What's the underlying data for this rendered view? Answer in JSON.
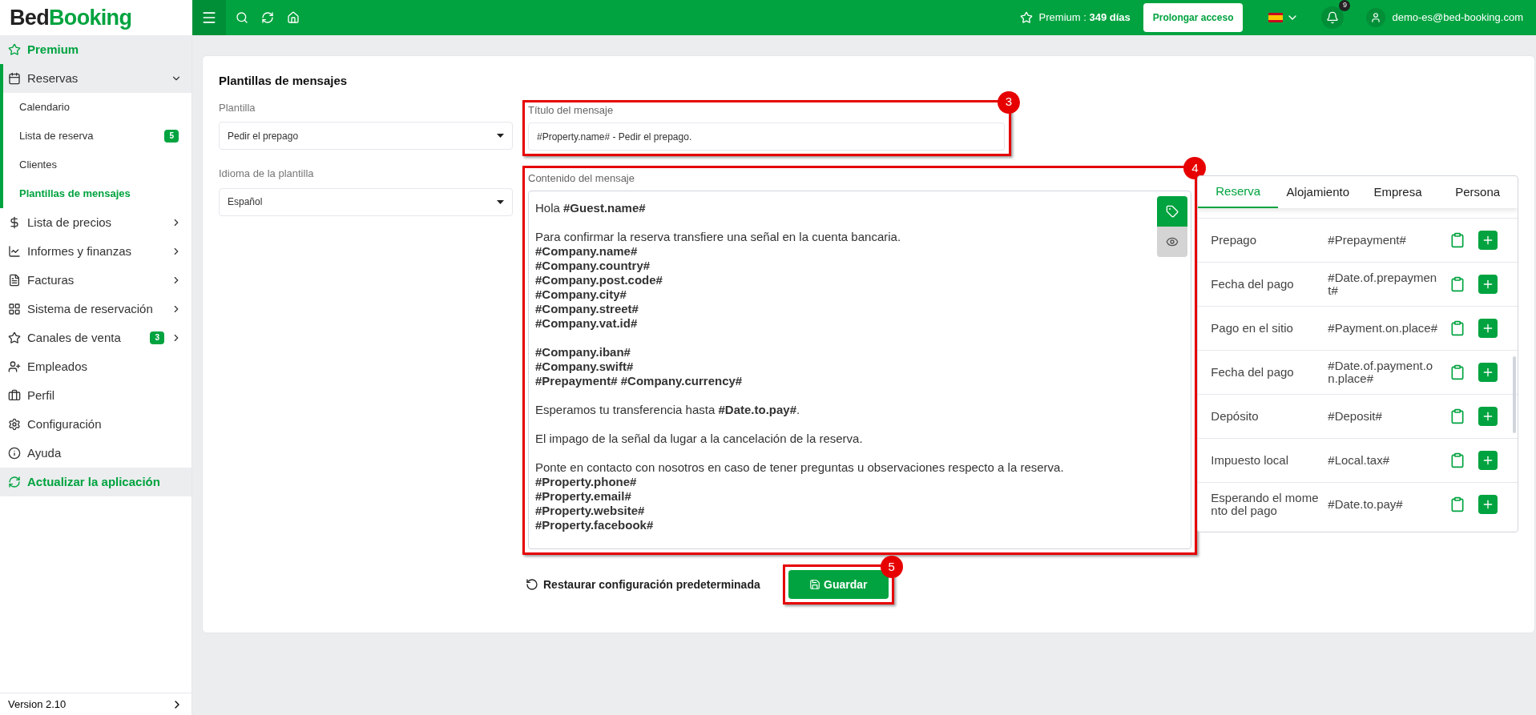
{
  "topbar": {
    "logo_left": "Bed",
    "logo_right": "Booking",
    "premium_label": "Premium : ",
    "premium_days": "349 días",
    "extend_button": "Prolongar acceso",
    "notifications": "9",
    "user_email": "demo-es@bed-booking.com"
  },
  "sidebar": {
    "items": [
      {
        "kind": "highlight",
        "label": "Premium"
      },
      {
        "kind": "group",
        "label": "Reservas",
        "expanded": true,
        "children": [
          {
            "label": "Calendario",
            "selected": false
          },
          {
            "label": "Lista de reserva",
            "selected": false,
            "badge": "5"
          },
          {
            "label": "Clientes",
            "selected": false
          },
          {
            "label": "Plantillas de mensajes",
            "selected": true
          }
        ]
      },
      {
        "kind": "group",
        "label": "Lista de precios",
        "expanded": false
      },
      {
        "kind": "group",
        "label": "Informes y finanzas",
        "expanded": false
      },
      {
        "kind": "group",
        "label": "Facturas",
        "expanded": false
      },
      {
        "kind": "group",
        "label": "Sistema de reservación",
        "expanded": false
      },
      {
        "kind": "group",
        "label": "Canales de venta",
        "expanded": false,
        "badge": "3"
      },
      {
        "kind": "link",
        "label": "Empleados"
      },
      {
        "kind": "link",
        "label": "Perfil"
      },
      {
        "kind": "link",
        "label": "Configuración"
      },
      {
        "kind": "link",
        "label": "Ayuda"
      },
      {
        "kind": "highlight",
        "label": "Actualizar la aplicación"
      }
    ],
    "version": "Version 2.10"
  },
  "page": {
    "title": "Plantillas de mensajes",
    "template": {
      "label": "Plantilla",
      "value": "Pedir el prepago"
    },
    "language": {
      "label": "Idioma de la plantilla",
      "value": "Español"
    },
    "message_title": {
      "label": "Título del mensaje",
      "value": "#Property.name# - Pedir el prepago.",
      "annotation": "3"
    },
    "message_content": {
      "label": "Contenido del mensaje",
      "annotation": "4",
      "paragraphs": [
        [
          {
            "text": "Hola **#Guest.name#**",
            "bold": false
          }
        ],
        [
          {
            "text": "Para confirmar la reserva transfiere una señal en la cuenta bancaria.",
            "bold": false
          },
          {
            "text": "#Company.name#",
            "bold": true
          },
          {
            "text": "#Company.country#",
            "bold": true
          },
          {
            "text": "#Company.post.code#",
            "bold": true
          },
          {
            "text": "#Company.city#",
            "bold": true
          },
          {
            "text": "#Company.street#",
            "bold": true
          },
          {
            "text": "#Company.vat.id#",
            "bold": true
          }
        ],
        [
          {
            "text": "#Company.iban#",
            "bold": true
          },
          {
            "text": "#Company.swift#",
            "bold": true
          },
          {
            "text": "#Prepayment# #Company.currency#",
            "bold": true
          }
        ],
        [
          {
            "text": "Esperamos tu transferencia hasta **#Date.to.pay#**.",
            "bold": false
          }
        ],
        [
          {
            "text": "El impago de la señal da lugar a la cancelación de la reserva.",
            "bold": false
          }
        ],
        [
          {
            "text": "Ponte en contacto con nosotros en caso de tener preguntas u observaciones respecto a la reserva.",
            "bold": false
          },
          {
            "text": "#Property.phone#",
            "bold": true
          },
          {
            "text": "#Property.email#",
            "bold": true
          },
          {
            "text": "#Property.website#",
            "bold": true
          },
          {
            "text": "#Property.facebook#",
            "bold": true
          }
        ]
      ]
    },
    "variables": {
      "tabs": [
        {
          "label": "Reserva",
          "selected": true
        },
        {
          "label": "Alojamiento",
          "selected": false
        },
        {
          "label": "Empresa",
          "selected": false
        },
        {
          "label": "Persona",
          "selected": false
        }
      ],
      "rows": [
        {
          "name": "Prepago",
          "code": "#Prepayment#"
        },
        {
          "name": "Fecha del pago",
          "code": "#Date.of.prepaymen t#"
        },
        {
          "name": "Pago en el sitio",
          "code": "#Payment.on.place#"
        },
        {
          "name": "Fecha del pago",
          "code": "#Date.of.payment.o n.place#"
        },
        {
          "name": "Depósito",
          "code": "#Deposit#"
        },
        {
          "name": "Impuesto local",
          "code": "#Local.tax#"
        },
        {
          "name": "Esperando el mome nto del pago",
          "code": "#Date.to.pay#"
        }
      ]
    },
    "restore_button": "Restaurar configuración predeterminada",
    "save_button": {
      "label": "Guardar",
      "annotation": "5"
    }
  }
}
